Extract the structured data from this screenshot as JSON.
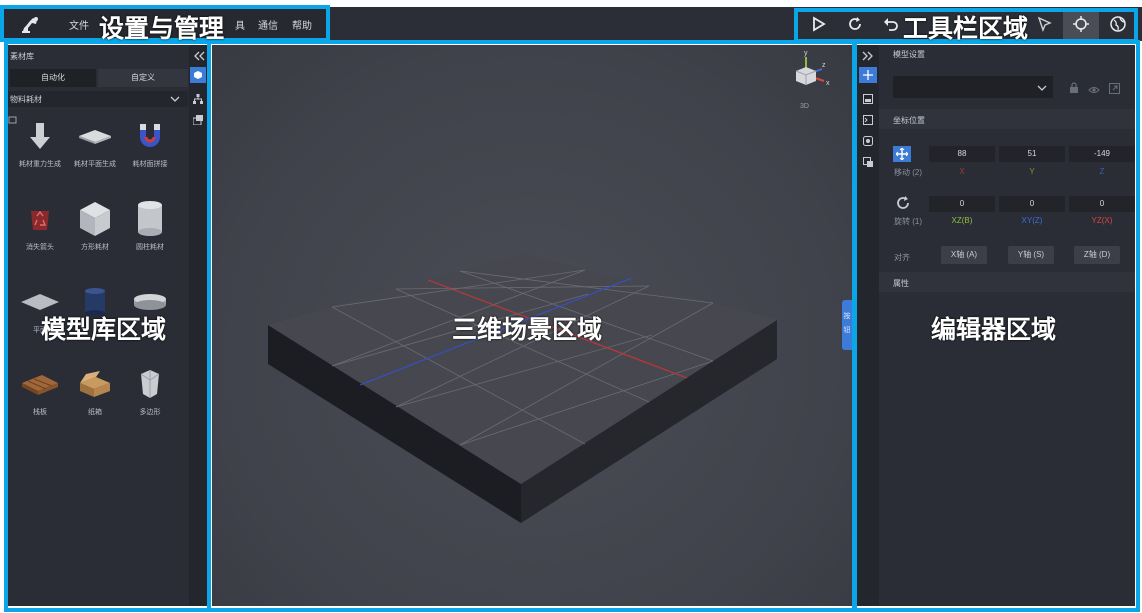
{
  "annotations": {
    "settings": "设置与管理",
    "toolbar": "工具栏区域",
    "library": "模型库区域",
    "scene": "三维场景区域",
    "editor": "编辑器区域"
  },
  "menu": {
    "file": "文件",
    "tools_fragment": "具",
    "comm": "通信",
    "help": "帮助"
  },
  "toolbar_icons": [
    "play-icon",
    "refresh-icon",
    "undo-icon",
    "pointer-icon",
    "crosshair-icon",
    "globe-icon"
  ],
  "library": {
    "title": "素材库",
    "tabs": {
      "auto": "自动化",
      "custom": "自定义"
    },
    "category": "物料耗材",
    "items": [
      {
        "label": "耗材重力生成",
        "icon": "arrow-down-icon"
      },
      {
        "label": "耗材平面生成",
        "icon": "plane-icon"
      },
      {
        "label": "耗材面拼接",
        "icon": "magnet-icon"
      },
      {
        "label": "消失箭头",
        "icon": "recycle-icon"
      },
      {
        "label": "方形耗材",
        "icon": "cube-icon"
      },
      {
        "label": "圆柱耗材",
        "icon": "cylinder-icon"
      },
      {
        "label": "平面",
        "icon": "flat-icon"
      },
      {
        "label": "",
        "icon": "drum-icon"
      },
      {
        "label": "",
        "icon": "disc-icon"
      },
      {
        "label": "栈板",
        "icon": "pallet-icon"
      },
      {
        "label": "纸箱",
        "icon": "box-icon"
      },
      {
        "label": "多边形",
        "icon": "polygon-icon"
      }
    ]
  },
  "scene": {
    "gizmo_mode": "3D",
    "axes": {
      "x": "x",
      "y": "y",
      "z": "z"
    },
    "side_tab": [
      "按",
      "钮"
    ]
  },
  "editor": {
    "model_settings": "模型设置",
    "coord_title": "坐标位置",
    "move_label": "移动 (2)",
    "move": {
      "x": "88",
      "y": "51",
      "z": "-149"
    },
    "move_axes": {
      "x": "X",
      "y": "Y",
      "z": "Z"
    },
    "rotate_label": "旋转 (1)",
    "rotate": {
      "xz": "0",
      "xy": "0",
      "yz": "0"
    },
    "rotate_axes": {
      "xz": "XZ(B)",
      "xy": "XY(Z)",
      "yz": "YZ(X)"
    },
    "align_label": "对齐",
    "align": {
      "x": "X轴 (A)",
      "y": "Y轴 (S)",
      "z": "Z轴 (D)"
    },
    "props_title": "属性"
  },
  "colors": {
    "highlight": "#0aa6e8",
    "accent": "#3d7bd8",
    "x_axis": "#d9473f",
    "y_axis": "#8fbf3a",
    "z_axis": "#3d6ed8"
  }
}
